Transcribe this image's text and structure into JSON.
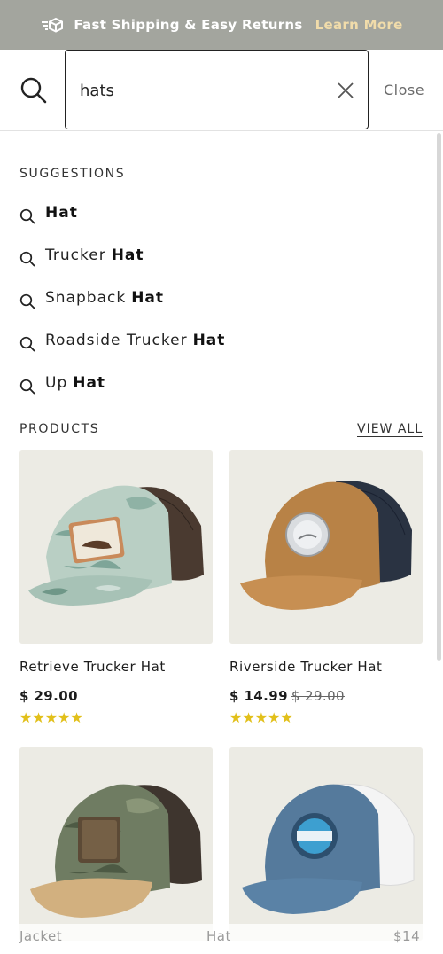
{
  "banner": {
    "text": "Fast Shipping & Easy Returns",
    "link": "Learn More",
    "icon": "shipping-box-icon"
  },
  "search": {
    "value": "hats",
    "placeholder": "Search",
    "close_label": "Close"
  },
  "suggestions": {
    "title": "SUGGESTIONS",
    "items": [
      {
        "plain": "",
        "bold": "Hat"
      },
      {
        "plain": "Trucker",
        "bold": "Hat"
      },
      {
        "plain": "Snapback",
        "bold": "Hat"
      },
      {
        "plain": "Roadside Trucker",
        "bold": "Hat"
      },
      {
        "plain": "Up",
        "bold": "Hat"
      }
    ]
  },
  "products": {
    "title": "PRODUCTS",
    "view_all": "VIEW ALL",
    "items": [
      {
        "name": "Retrieve Trucker Hat",
        "price": "$ 29.00",
        "old_price": "",
        "rating": "★★★★★"
      },
      {
        "name": "Riverside Trucker Hat",
        "price": "$ 14.99",
        "old_price": "$ 29.00",
        "rating": "★★★★★"
      },
      {
        "name": "",
        "price": "",
        "old_price": "",
        "rating": ""
      },
      {
        "name": "",
        "price": "",
        "old_price": "",
        "rating": ""
      }
    ]
  },
  "bottom_strip": {
    "left": "Jacket",
    "middle": "Hat",
    "right": "$14"
  },
  "colors": {
    "banner_bg": "#a3a59e",
    "banner_link": "#f1dcaa",
    "star": "#e2c01b",
    "card_bg": "#ecebe4"
  }
}
